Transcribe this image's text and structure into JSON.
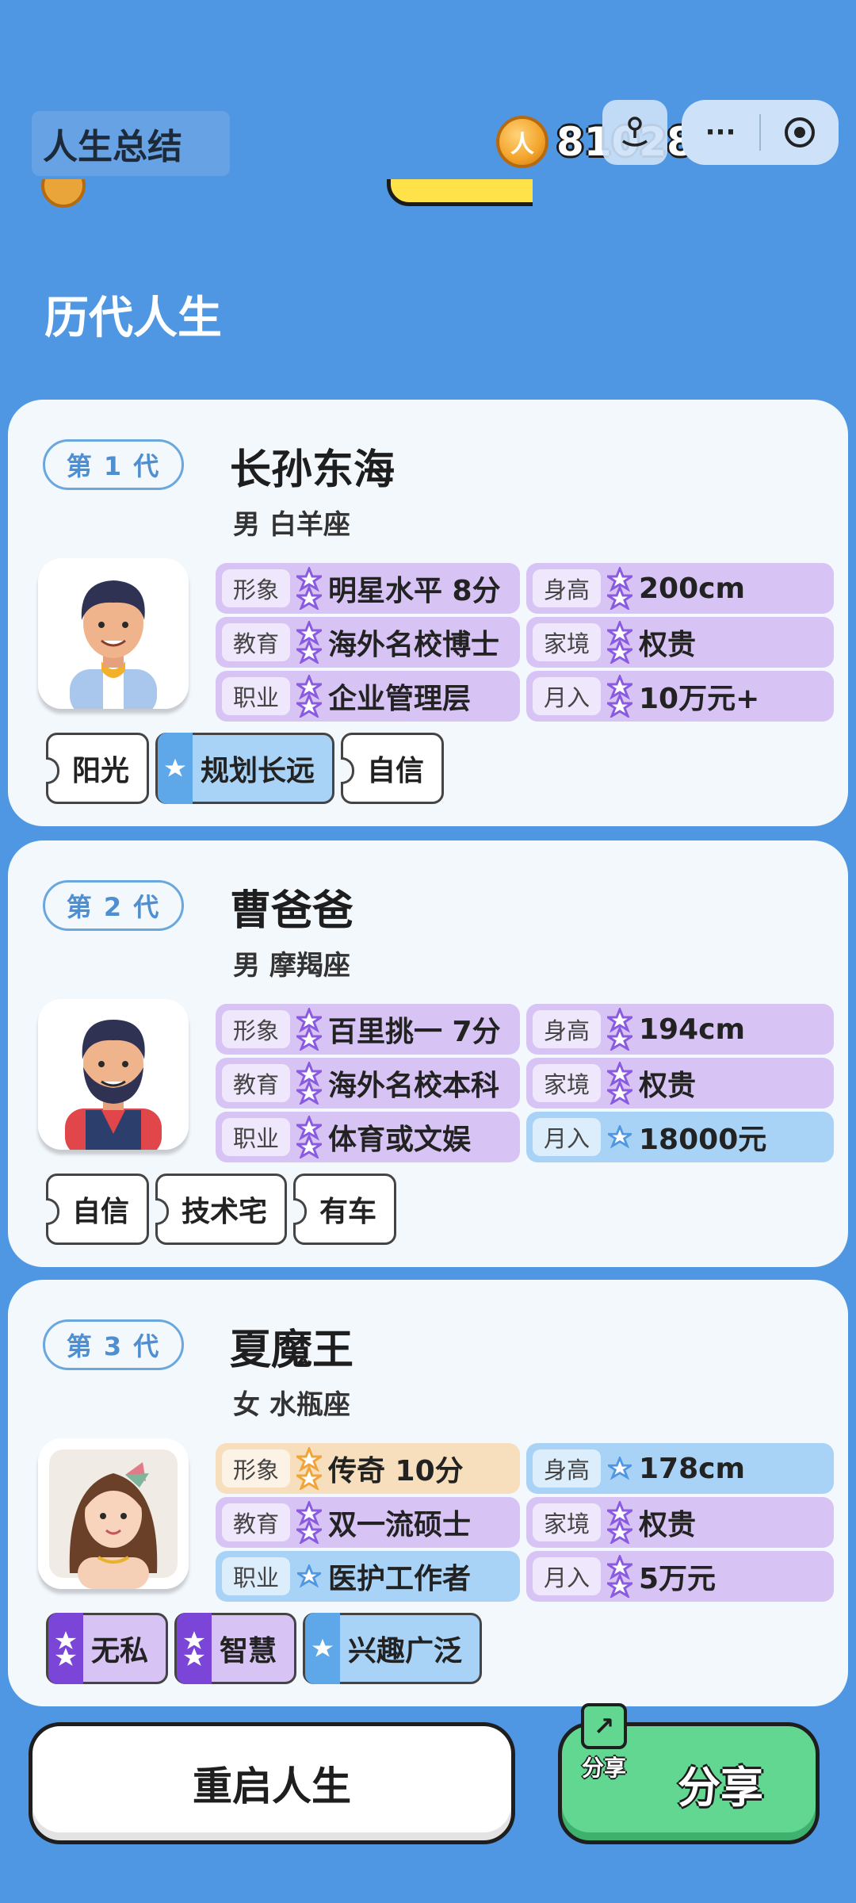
{
  "header": {
    "title": "人生总结",
    "coin_symbol": "人",
    "coin_value": "81028",
    "menu_icon": "more-dots-icon",
    "close_icon": "target-circle-icon"
  },
  "section_title": "历代人生",
  "labels": {
    "look": "形象",
    "height": "身高",
    "education": "教育",
    "family": "家境",
    "job": "职业",
    "income": "月入"
  },
  "generations": [
    {
      "badge": "第 1 代",
      "name": "长孙东海",
      "meta": "男 白羊座",
      "look": "明星水平 8分",
      "height": "200cm",
      "education": "海外名校博士",
      "family": "权贵",
      "job": "企业管理层",
      "income": "10万元+",
      "tags": [
        "阳光",
        "规划长远",
        "自信"
      ]
    },
    {
      "badge": "第 2 代",
      "name": "曹爸爸",
      "meta": "男 摩羯座",
      "look": "百里挑一 7分",
      "height": "194cm",
      "education": "海外名校本科",
      "family": "权贵",
      "job": "体育或文娱",
      "income": "18000元",
      "tags": [
        "自信",
        "技术宅",
        "有车"
      ]
    },
    {
      "badge": "第 3 代",
      "name": "夏魔王",
      "meta": "女 水瓶座",
      "look": "传奇 10分",
      "height": "178cm",
      "education": "双一流硕士",
      "family": "权贵",
      "job": "医护工作者",
      "income": "5万元",
      "tags": [
        "无私",
        "智慧",
        "兴趣广泛"
      ]
    }
  ],
  "buttons": {
    "restart": "重启人生",
    "share": "分享",
    "share_icon_caption": "分享"
  },
  "colors": {
    "background": "#4f97e2",
    "card": "#f3f8fd",
    "purple_tier": "#d8c4f4",
    "blue_tier": "#a9d3f6",
    "orange_tier": "#f7dfbe",
    "share_green": "#62d791"
  }
}
